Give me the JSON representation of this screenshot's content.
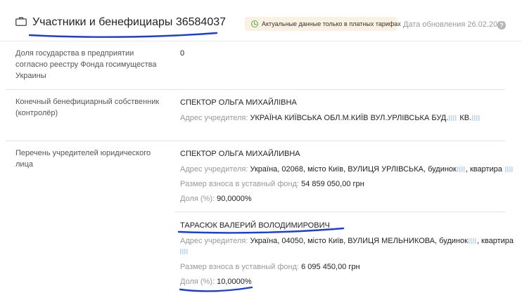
{
  "header": {
    "title": "Участники и бенефициары 36584037",
    "badge": "Актуальные данные только в платных тарифах",
    "updated": "Дата обновления 26.02.2021",
    "help": "?"
  },
  "rows": {
    "state_share": {
      "label": "Доля государства в предприятии согласно реестру Фонда госимущества Украины",
      "value": "0"
    },
    "beneficiary": {
      "label": "Конечный бенефициарный собственник (контролёр)",
      "name": "СПЕКТОР ОЛЬГА МИХАЙЛІВНА",
      "address_label": "Адрес учредителя:",
      "address": "УКРАЇНА КИЇВСЬКА ОБЛ.М.КИЇВ ВУЛ.УРЛІВСЬКА БУД.",
      "address_tail": "КВ."
    },
    "founders": {
      "label": "Перечень учредителей юридического лица",
      "items": [
        {
          "name": "СПЕКТОР ОЛЬГА МИХАЙЛИВНА",
          "address_label": "Адрес учредителя:",
          "address": "Україна, 02068, місто Київ, ВУЛИЦЯ УРЛІВСЬКА, будинок",
          "address_tail": ", квартира",
          "contribution_label": "Размер взноса в уставный фонд:",
          "contribution": "54 859 050,00 грн",
          "share_label": "Доля (%):",
          "share": "90,0000%"
        },
        {
          "name": "ТАРАСЮК ВАЛЕРИЙ ВОЛОДИМИРОВИЧ",
          "address_label": "Адрес учредителя:",
          "address": "Україна, 04050, місто Київ, ВУЛИЦЯ МЕЛЬНИКОВА, будинок",
          "address_tail": ", квартира",
          "contribution_label": "Размер взноса в уставный фонд:",
          "contribution": "6 095 450,00 грн",
          "share_label": "Доля (%):",
          "share": "10,0000%"
        }
      ]
    }
  },
  "colors": {
    "annotation": "#1a3fd6",
    "badge_bg": "#fbf1e3",
    "badge_icon": "#4caf50",
    "mask": "#b8d4f2"
  }
}
